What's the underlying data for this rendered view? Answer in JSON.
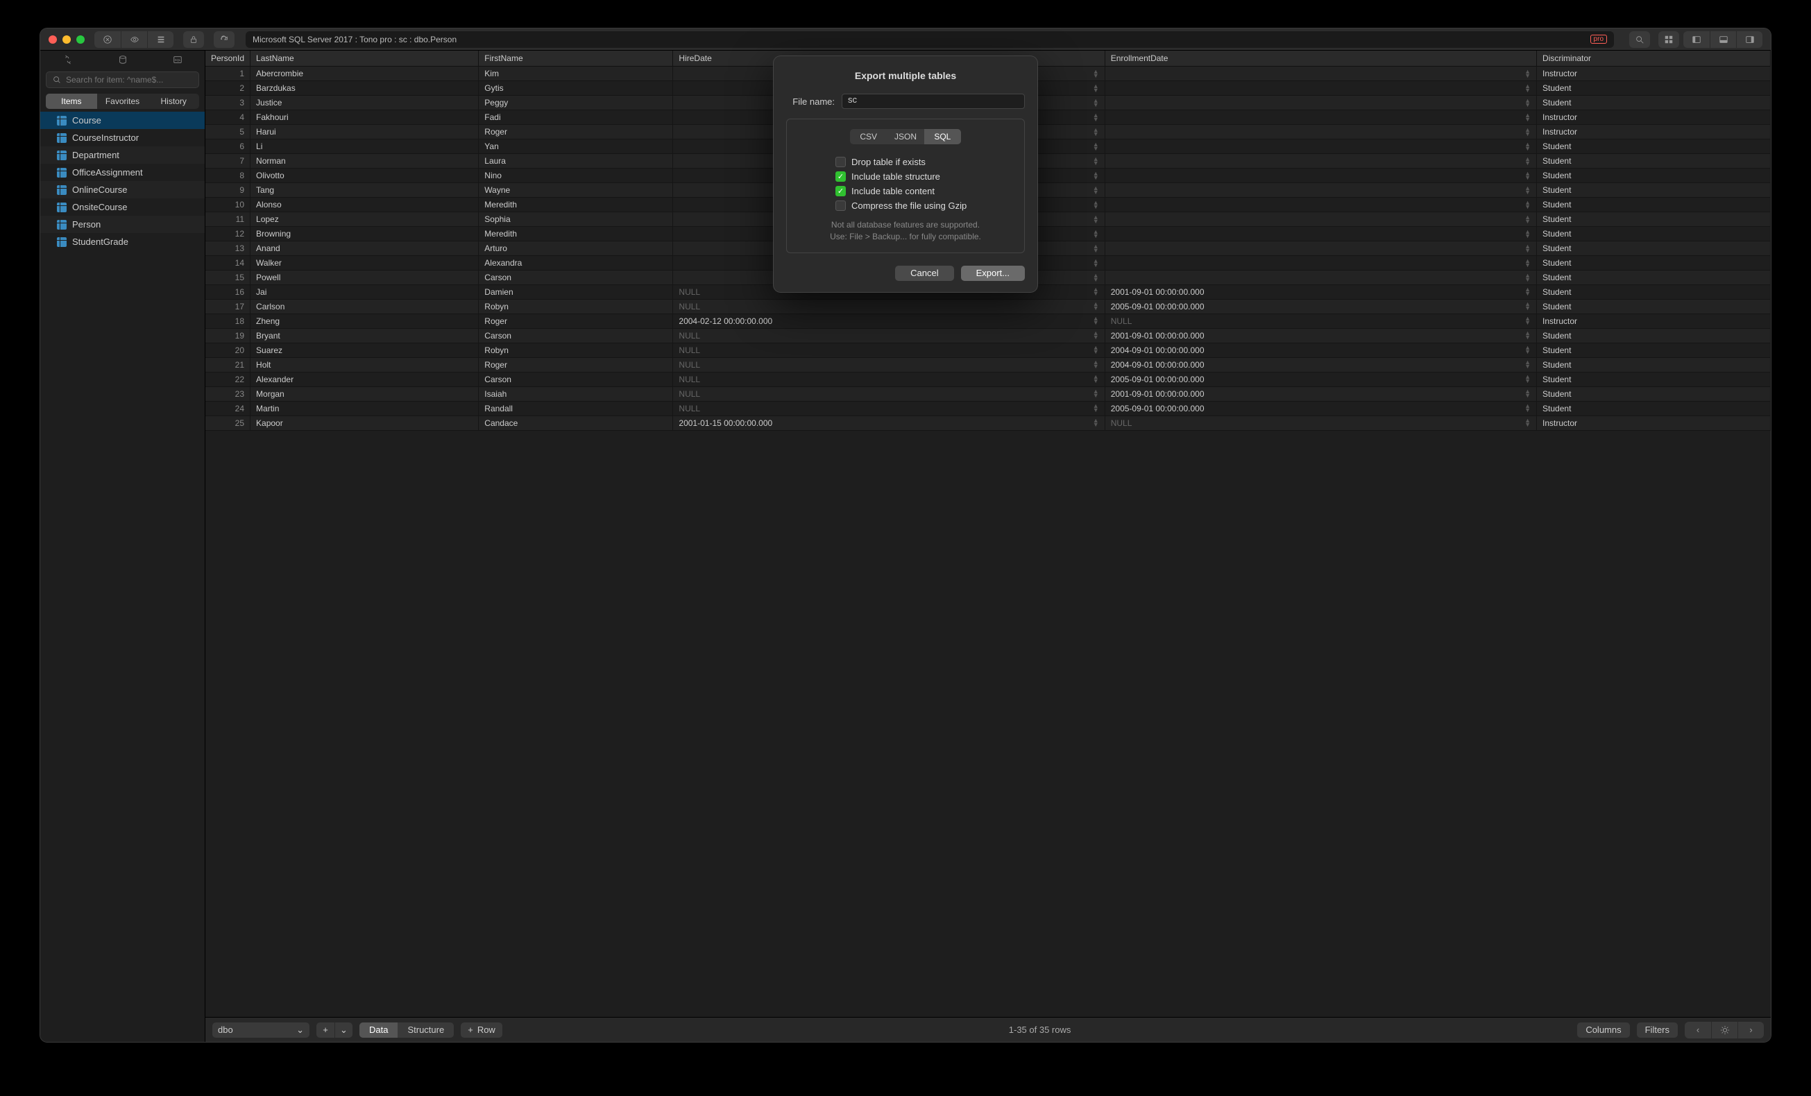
{
  "titlebar": {
    "path": "Microsoft SQL Server 2017 : Tono pro : sc : dbo.Person",
    "pro_badge": "pro"
  },
  "sidebar": {
    "search_placeholder": "Search for item: ^name$...",
    "tabs": [
      "Items",
      "Favorites",
      "History"
    ],
    "active_tab": 0,
    "tables": [
      "Course",
      "CourseInstructor",
      "Department",
      "OfficeAssignment",
      "OnlineCourse",
      "OnsiteCourse",
      "Person",
      "StudentGrade"
    ],
    "selected_table": "Course"
  },
  "columns": [
    "PersonId",
    "LastName",
    "FirstName",
    "HireDate",
    "EnrollmentDate",
    "Discriminator"
  ],
  "rows": [
    {
      "id": 1,
      "last": "Abercrombie",
      "first": "Kim",
      "hire": "",
      "enroll": "",
      "disc": "Instructor"
    },
    {
      "id": 2,
      "last": "Barzdukas",
      "first": "Gytis",
      "hire": "",
      "enroll": "",
      "disc": "Student"
    },
    {
      "id": 3,
      "last": "Justice",
      "first": "Peggy",
      "hire": "",
      "enroll": "",
      "disc": "Student"
    },
    {
      "id": 4,
      "last": "Fakhouri",
      "first": "Fadi",
      "hire": "",
      "enroll": "",
      "disc": "Instructor"
    },
    {
      "id": 5,
      "last": "Harui",
      "first": "Roger",
      "hire": "",
      "enroll": "",
      "disc": "Instructor"
    },
    {
      "id": 6,
      "last": "Li",
      "first": "Yan",
      "hire": "",
      "enroll": "",
      "disc": "Student"
    },
    {
      "id": 7,
      "last": "Norman",
      "first": "Laura",
      "hire": "",
      "enroll": "",
      "disc": "Student"
    },
    {
      "id": 8,
      "last": "Olivotto",
      "first": "Nino",
      "hire": "",
      "enroll": "",
      "disc": "Student"
    },
    {
      "id": 9,
      "last": "Tang",
      "first": "Wayne",
      "hire": "",
      "enroll": "",
      "disc": "Student"
    },
    {
      "id": 10,
      "last": "Alonso",
      "first": "Meredith",
      "hire": "",
      "enroll": "",
      "disc": "Student"
    },
    {
      "id": 11,
      "last": "Lopez",
      "first": "Sophia",
      "hire": "",
      "enroll": "",
      "disc": "Student"
    },
    {
      "id": 12,
      "last": "Browning",
      "first": "Meredith",
      "hire": "",
      "enroll": "",
      "disc": "Student"
    },
    {
      "id": 13,
      "last": "Anand",
      "first": "Arturo",
      "hire": "",
      "enroll": "",
      "disc": "Student"
    },
    {
      "id": 14,
      "last": "Walker",
      "first": "Alexandra",
      "hire": "",
      "enroll": "",
      "disc": "Student"
    },
    {
      "id": 15,
      "last": "Powell",
      "first": "Carson",
      "hire": "",
      "enroll": "",
      "disc": "Student"
    },
    {
      "id": 16,
      "last": "Jai",
      "first": "Damien",
      "hire": "NULL",
      "enroll": "2001-09-01 00:00:00.000",
      "disc": "Student"
    },
    {
      "id": 17,
      "last": "Carlson",
      "first": "Robyn",
      "hire": "NULL",
      "enroll": "2005-09-01 00:00:00.000",
      "disc": "Student"
    },
    {
      "id": 18,
      "last": "Zheng",
      "first": "Roger",
      "hire": "2004-02-12 00:00:00.000",
      "enroll": "NULL",
      "disc": "Instructor"
    },
    {
      "id": 19,
      "last": "Bryant",
      "first": "Carson",
      "hire": "NULL",
      "enroll": "2001-09-01 00:00:00.000",
      "disc": "Student"
    },
    {
      "id": 20,
      "last": "Suarez",
      "first": "Robyn",
      "hire": "NULL",
      "enroll": "2004-09-01 00:00:00.000",
      "disc": "Student"
    },
    {
      "id": 21,
      "last": "Holt",
      "first": "Roger",
      "hire": "NULL",
      "enroll": "2004-09-01 00:00:00.000",
      "disc": "Student"
    },
    {
      "id": 22,
      "last": "Alexander",
      "first": "Carson",
      "hire": "NULL",
      "enroll": "2005-09-01 00:00:00.000",
      "disc": "Student"
    },
    {
      "id": 23,
      "last": "Morgan",
      "first": "Isaiah",
      "hire": "NULL",
      "enroll": "2001-09-01 00:00:00.000",
      "disc": "Student"
    },
    {
      "id": 24,
      "last": "Martin",
      "first": "Randall",
      "hire": "NULL",
      "enroll": "2005-09-01 00:00:00.000",
      "disc": "Student"
    },
    {
      "id": 25,
      "last": "Kapoor",
      "first": "Candace",
      "hire": "2001-01-15 00:00:00.000",
      "enroll": "NULL",
      "disc": "Instructor"
    }
  ],
  "footer": {
    "schema": "dbo",
    "view_tabs": [
      "Data",
      "Structure"
    ],
    "active_view": 0,
    "row_btn": "Row",
    "row_count": "1-35 of 35 rows",
    "columns_btn": "Columns",
    "filters_btn": "Filters"
  },
  "modal": {
    "title": "Export multiple tables",
    "file_name_label": "File name:",
    "file_name": "sc",
    "formats": [
      "CSV",
      "JSON",
      "SQL"
    ],
    "active_format": 2,
    "options": [
      {
        "label": "Drop table if exists",
        "checked": false
      },
      {
        "label": "Include table structure",
        "checked": true
      },
      {
        "label": "Include table content",
        "checked": true
      },
      {
        "label": "Compress the file using Gzip",
        "checked": false
      }
    ],
    "note1": "Not all database features are supported.",
    "note2": "Use: File > Backup... for fully compatible.",
    "cancel": "Cancel",
    "export": "Export..."
  }
}
